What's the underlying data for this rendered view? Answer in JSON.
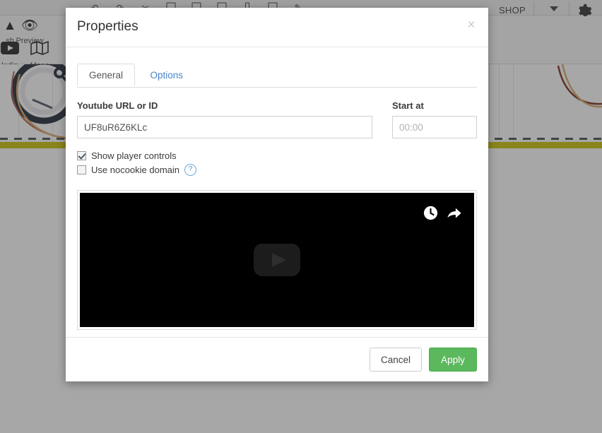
{
  "background": {
    "toolbar_icons": [
      "undo-icon",
      "redo-icon",
      "cut-icon",
      "copy-icon",
      "paste-icon",
      "box-icon",
      "columns-icon",
      "frame-icon",
      "brush-icon"
    ],
    "shop_label": "SHOP",
    "buttons": [
      {
        "label": "sh",
        "icon": "publish-icon"
      },
      {
        "label": "Preview",
        "icon": "eye-icon"
      },
      {
        "label": "ledia",
        "icon": "media-icon"
      },
      {
        "label": "Maps",
        "icon": "map-icon"
      }
    ]
  },
  "modal": {
    "title": "Properties",
    "close_label": "×",
    "tabs": [
      {
        "label": "General",
        "active": true
      },
      {
        "label": "Options",
        "active": false
      }
    ],
    "fields": {
      "url": {
        "label": "Youtube URL or ID",
        "value": "UF8uR6Z6KLc",
        "placeholder": ""
      },
      "start": {
        "label": "Start at",
        "value": "",
        "placeholder": "00:00"
      }
    },
    "checkboxes": [
      {
        "label": "Show player controls",
        "checked": true,
        "help": false
      },
      {
        "label": "Use nocookie domain",
        "checked": false,
        "help": true,
        "help_glyph": "?"
      }
    ],
    "player": {
      "play_icon": "play-button-icon",
      "watch_later_icon": "clock-icon",
      "share_icon": "share-arrow-icon"
    },
    "footer": {
      "cancel_label": "Cancel",
      "apply_label": "Apply"
    }
  },
  "colors": {
    "apply_green": "#5cb85c",
    "tab_link_blue": "#4a86c8",
    "help_blue": "#4a90c4",
    "band_yellow": "#c8c200"
  }
}
